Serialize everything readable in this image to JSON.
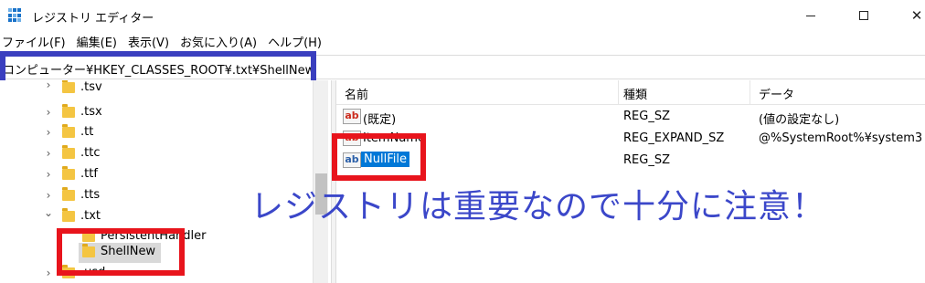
{
  "window": {
    "title": "レジストリ エディター",
    "close_glyph": "✕"
  },
  "menu": [
    {
      "label": "ファイル(F)"
    },
    {
      "label": "編集(E)"
    },
    {
      "label": "表示(V)"
    },
    {
      "label": "お気に入り(A)"
    },
    {
      "label": "ヘルプ(H)"
    }
  ],
  "address": {
    "path": "コンピューター¥HKEY_CLASSES_ROOT¥.txt¥ShellNew"
  },
  "tree": {
    "items": [
      {
        "label": ".tsv",
        "chevron": "›"
      },
      {
        "label": ".tsx",
        "chevron": "›"
      },
      {
        "label": ".tt",
        "chevron": "›"
      },
      {
        "label": ".ttc",
        "chevron": "›"
      },
      {
        "label": ".ttf",
        "chevron": "›"
      },
      {
        "label": ".tts",
        "chevron": "›"
      },
      {
        "label": ".txt",
        "chevron": "⌄"
      },
      {
        "label": "PersistentHandler",
        "chevron": ""
      },
      {
        "label": "ShellNew",
        "chevron": ""
      },
      {
        "label": ".usd",
        "chevron": "›"
      }
    ]
  },
  "list": {
    "headers": {
      "name": "名前",
      "type": "種類",
      "data": "データ"
    },
    "rows": [
      {
        "icon": "ab",
        "name": "(既定)",
        "type": "REG_SZ",
        "data": "(値の設定なし)"
      },
      {
        "icon": "ab",
        "name": "ItemName",
        "type": "REG_EXPAND_SZ",
        "data": "@%SystemRoot%¥system3"
      },
      {
        "icon": "ab",
        "name": "NullFile",
        "type": "REG_SZ",
        "data": ""
      }
    ]
  },
  "annotation": {
    "text": "レジストリは重要なので十分に注意！",
    "color": "#3b47c9"
  },
  "highlight_colors": {
    "red": "#e8141c",
    "blue": "#3a3fbf",
    "selection": "#0078d7"
  }
}
